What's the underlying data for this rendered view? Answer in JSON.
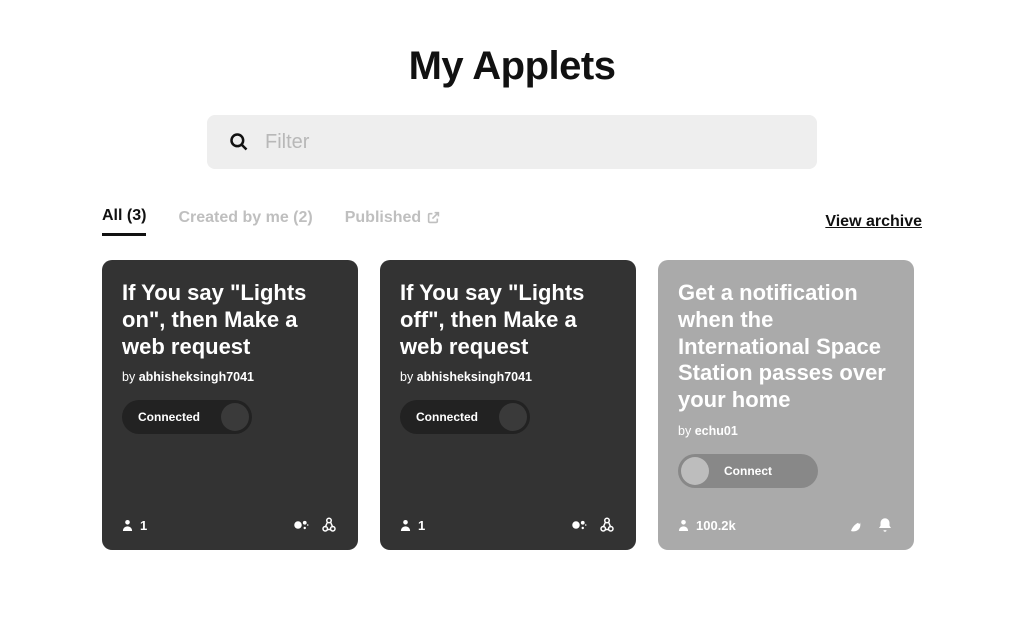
{
  "page_title": "My Applets",
  "search": {
    "placeholder": "Filter"
  },
  "tabs": {
    "all": "All (3)",
    "created": "Created by me (2)",
    "published": "Published"
  },
  "archive_link": "View archive",
  "cards": [
    {
      "title": "If You say \"Lights on\", then Make a web request",
      "author_prefix": "by ",
      "author": "abhisheksingh7041",
      "toggle_label": "Connected",
      "users": "1"
    },
    {
      "title": "If You say \"Lights off\", then Make a web request",
      "author_prefix": "by ",
      "author": "abhisheksingh7041",
      "toggle_label": "Connected",
      "users": "1"
    },
    {
      "title": "Get a notification when the International Space Station passes over your home",
      "author_prefix": "by ",
      "author": "echu01",
      "toggle_label": "Connect",
      "users": "100.2k"
    }
  ]
}
